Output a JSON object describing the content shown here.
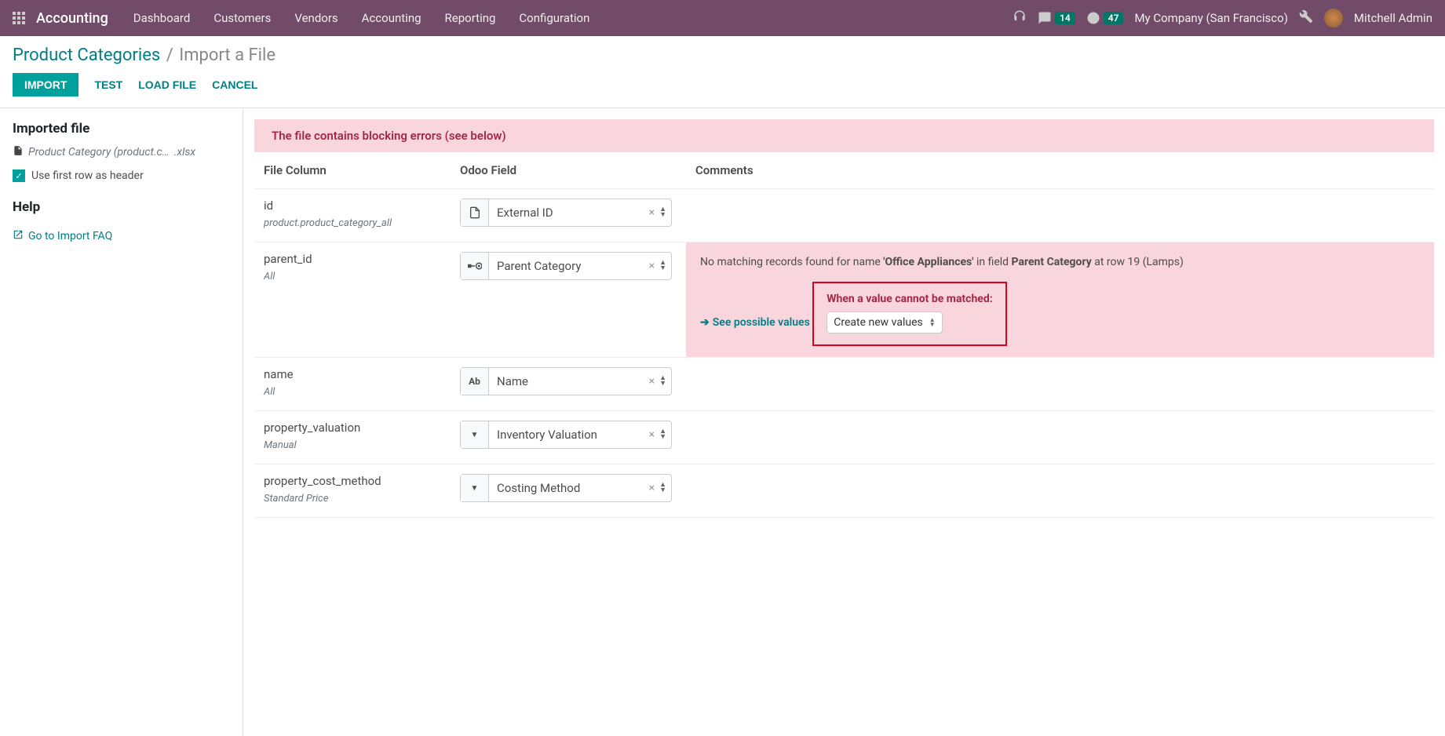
{
  "navbar": {
    "brand": "Accounting",
    "menu": [
      "Dashboard",
      "Customers",
      "Vendors",
      "Accounting",
      "Reporting",
      "Configuration"
    ],
    "messages_count": "14",
    "activities_count": "47",
    "company": "My Company (San Francisco)",
    "user": "Mitchell Admin"
  },
  "breadcrumb": {
    "parent": "Product Categories",
    "current": "Import a File"
  },
  "buttons": {
    "import": "IMPORT",
    "test": "TEST",
    "load": "LOAD FILE",
    "cancel": "CANCEL"
  },
  "sidebar": {
    "imported_heading": "Imported file",
    "file_name": "Product Category (product.c…",
    "file_ext": ".xlsx",
    "header_checkbox_label": "Use first row as header",
    "header_checkbox_checked": true,
    "help_heading": "Help",
    "faq_link": "Go to Import FAQ"
  },
  "alert": "The file contains blocking errors (see below)",
  "headers": {
    "file_column": "File Column",
    "odoo_field": "Odoo Field",
    "comments": "Comments"
  },
  "rows": [
    {
      "col": "id",
      "sample": "product.product_category_all",
      "icon": "file",
      "field": "External ID"
    },
    {
      "col": "parent_id",
      "sample": "All",
      "icon": "relation",
      "field": "Parent Category",
      "error": {
        "prefix": "No matching records found for name ",
        "value": "'Office Appliances'",
        "mid": " in field ",
        "field": "Parent Category",
        "suffix": " at row 19 (Lamps)",
        "see": "See possible values",
        "mismatch_label": "When a value cannot be matched:",
        "mismatch_option": "Create new values"
      }
    },
    {
      "col": "name",
      "sample": "All",
      "icon": "text",
      "field": "Name"
    },
    {
      "col": "property_valuation",
      "sample": "Manual",
      "icon": "dropdown",
      "field": "Inventory Valuation"
    },
    {
      "col": "property_cost_method",
      "sample": "Standard Price",
      "icon": "dropdown",
      "field": "Costing Method"
    }
  ]
}
